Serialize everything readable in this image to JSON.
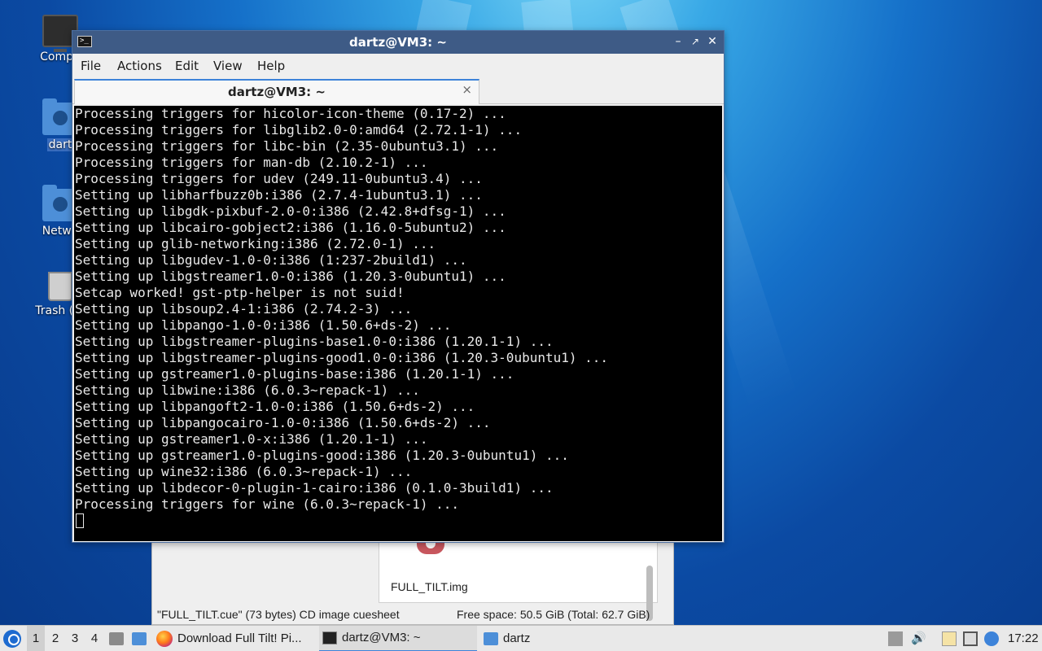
{
  "desktop": {
    "icons": [
      {
        "label": "Compu",
        "kind": "computer"
      },
      {
        "label": "dart",
        "kind": "home"
      },
      {
        "label": "Netwo",
        "kind": "network"
      },
      {
        "label": "Trash (Er",
        "kind": "trash"
      }
    ]
  },
  "file_manager": {
    "file_label": "FULL_TILT.img",
    "status_left": "\"FULL_TILT.cue\" (73 bytes) CD image cuesheet",
    "status_right": "Free space: 50.5 GiB (Total: 62.7 GiB)"
  },
  "terminal": {
    "window_title": "dartz@VM3: ~",
    "menu": [
      "File",
      "Actions",
      "Edit",
      "View",
      "Help"
    ],
    "tab_label": "dartz@VM3: ~",
    "lines": [
      "Processing triggers for hicolor-icon-theme (0.17-2) ...",
      "Processing triggers for libglib2.0-0:amd64 (2.72.1-1) ...",
      "Processing triggers for libc-bin (2.35-0ubuntu3.1) ...",
      "Processing triggers for man-db (2.10.2-1) ...",
      "Processing triggers for udev (249.11-0ubuntu3.4) ...",
      "Setting up libharfbuzz0b:i386 (2.7.4-1ubuntu3.1) ...",
      "Setting up libgdk-pixbuf-2.0-0:i386 (2.42.8+dfsg-1) ...",
      "Setting up libcairo-gobject2:i386 (1.16.0-5ubuntu2) ...",
      "Setting up glib-networking:i386 (2.72.0-1) ...",
      "Setting up libgudev-1.0-0:i386 (1:237-2build1) ...",
      "Setting up libgstreamer1.0-0:i386 (1.20.3-0ubuntu1) ...",
      "Setcap worked! gst-ptp-helper is not suid!",
      "Setting up libsoup2.4-1:i386 (2.74.2-3) ...",
      "Setting up libpango-1.0-0:i386 (1.50.6+ds-2) ...",
      "Setting up libgstreamer-plugins-base1.0-0:i386 (1.20.1-1) ...",
      "Setting up libgstreamer-plugins-good1.0-0:i386 (1.20.3-0ubuntu1) ...",
      "Setting up gstreamer1.0-plugins-base:i386 (1.20.1-1) ...",
      "Setting up libwine:i386 (6.0.3~repack-1) ...",
      "Setting up libpangoft2-1.0-0:i386 (1.50.6+ds-2) ...",
      "Setting up libpangocairo-1.0-0:i386 (1.50.6+ds-2) ...",
      "Setting up gstreamer1.0-x:i386 (1.20.1-1) ...",
      "Setting up gstreamer1.0-plugins-good:i386 (1.20.3-0ubuntu1) ...",
      "Setting up wine32:i386 (6.0.3~repack-1) ...",
      "Setting up libdecor-0-plugin-1-cairo:i386 (0.1.0-3build1) ...",
      "Processing triggers for wine (6.0.3~repack-1) ..."
    ]
  },
  "taskbar": {
    "workspaces": [
      "1",
      "2",
      "3",
      "4"
    ],
    "tasks": {
      "firefox": "Download Full Tilt! Pi...",
      "terminal": "dartz@VM3: ~",
      "files": "dartz"
    },
    "clock": "17:22"
  }
}
